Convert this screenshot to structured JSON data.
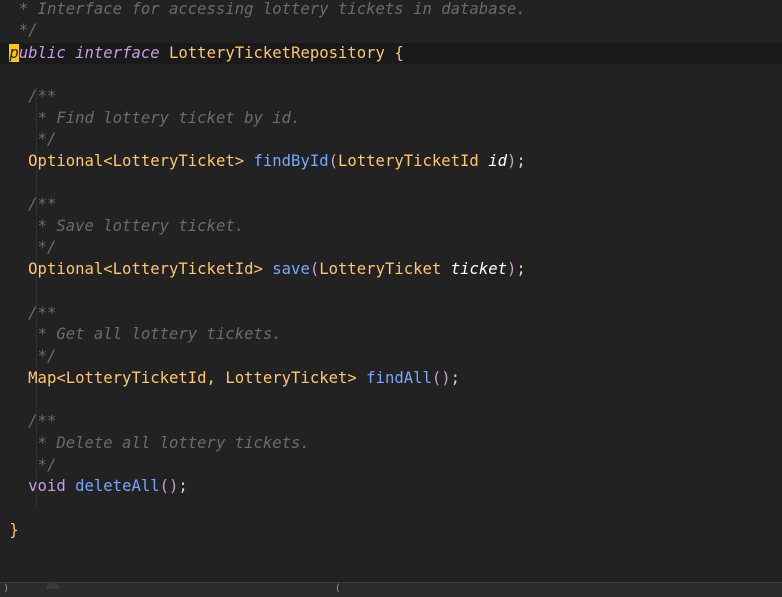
{
  "editor": {
    "lines": {
      "l0_comment": "* Interface for accessing lottery tickets in database.",
      "l1_comment": "*/",
      "l2_caret": "p",
      "l2_kw1": "ublic",
      "l2_kw2": "interface",
      "l2_name": "LotteryTicketRepository",
      "l2_brace": "{",
      "l4_comment": "/**",
      "l5_comment": "* Find lottery ticket by id.",
      "l6_comment": "*/",
      "l7_type": "Optional",
      "l7_generic": "<LotteryTicket>",
      "l7_fn": "findById",
      "l7_open": "(",
      "l7_ptype": "LotteryTicketId",
      "l7_param": "id",
      "l7_close": ")",
      "l7_semi": ";",
      "l9_comment": "/**",
      "l10_comment": "* Save lottery ticket.",
      "l11_comment": "*/",
      "l12_type": "Optional",
      "l12_generic": "<LotteryTicketId>",
      "l12_fn": "save",
      "l12_open": "(",
      "l12_ptype": "LotteryTicket",
      "l12_param": "ticket",
      "l12_close": ")",
      "l12_semi": ";",
      "l14_comment": "/**",
      "l15_comment": "* Get all lottery tickets.",
      "l16_comment": "*/",
      "l17_type": "Map",
      "l17_generic": "<LotteryTicketId, LotteryTicket>",
      "l17_fn": "findAll",
      "l17_parens": "()",
      "l17_semi": ";",
      "l19_comment": "/**",
      "l20_comment": "* Delete all lottery tickets.",
      "l21_comment": "*/",
      "l22_kw": "void",
      "l22_fn": "deleteAll",
      "l22_parens": "()",
      "l22_semi": ";",
      "l24_brace": "}"
    }
  },
  "statusbar": {
    "left": ")",
    "right": "("
  },
  "colors": {
    "background": "#222222",
    "comment": "#6b6b6b",
    "keyword": "#c79de6",
    "type": "#ffc66d",
    "function": "#7aa6ff",
    "parameter": "#ffffff",
    "caret": "#ffc800"
  }
}
